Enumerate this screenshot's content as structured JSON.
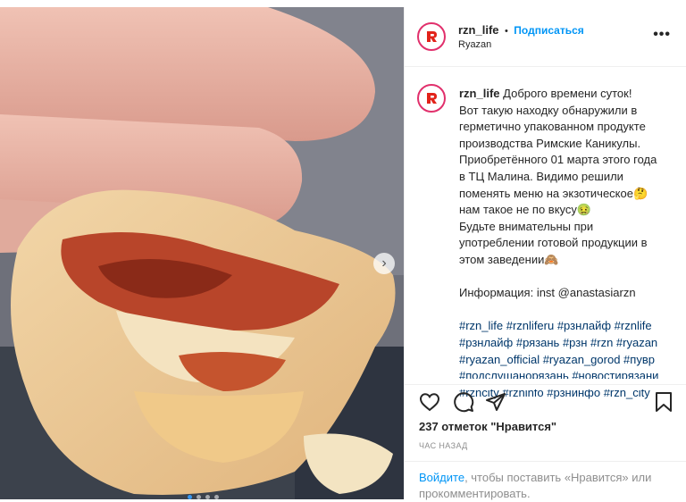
{
  "post": {
    "username": "rzn_life",
    "follow_label": "Подписаться",
    "bullet": "•",
    "location": "Ryazan",
    "more_label": "•••"
  },
  "caption": {
    "username": "rzn_life",
    "lines": [
      "Доброго времени суток!",
      "Вот такую находку обнаружили в",
      "герметично упакованном продукте",
      "производства Римские Каникулы.",
      "Приобретённого 01 марта этого года",
      "в ТЦ Малина. Видимо решили",
      "поменять меню на экзотическое🤔",
      "нам такое не по вкусу🤢",
      "Будьте внимательны при",
      "употреблении готовой продукции в",
      "этом заведении🙈",
      "",
      "Информация: inst @anastasiarzn",
      ""
    ],
    "hashtag_lines": [
      "#rzn_life #rznliferu #рзнлайф #rznlife",
      "#рзнлайф #рязань #рзн #rzn #ryazan",
      "#ryazan_official #ryazan_gorod #пувр",
      "#подслушанорязань #новостирязани",
      "#rzncity #rzninfo #рзнинфо #rzn_city"
    ]
  },
  "engagement": {
    "likes_text": "237 отметок \"Нравится\"",
    "time_text": "ЧАС НАЗАД"
  },
  "login_prompt": {
    "link": "Войдите",
    "text": ", чтобы поставить «Нравится» или прокомментировать."
  },
  "carousel": {
    "slide_count": 4,
    "active_index": 0
  },
  "colors": {
    "accent": "#0095f6",
    "avatar_ring": "#e1306c",
    "logo_red": "#e2231a",
    "hashtag": "#00376b"
  },
  "icons": [
    "heart-icon",
    "comment-icon",
    "share-icon",
    "bookmark-icon",
    "more-icon",
    "chevron-right-icon"
  ]
}
